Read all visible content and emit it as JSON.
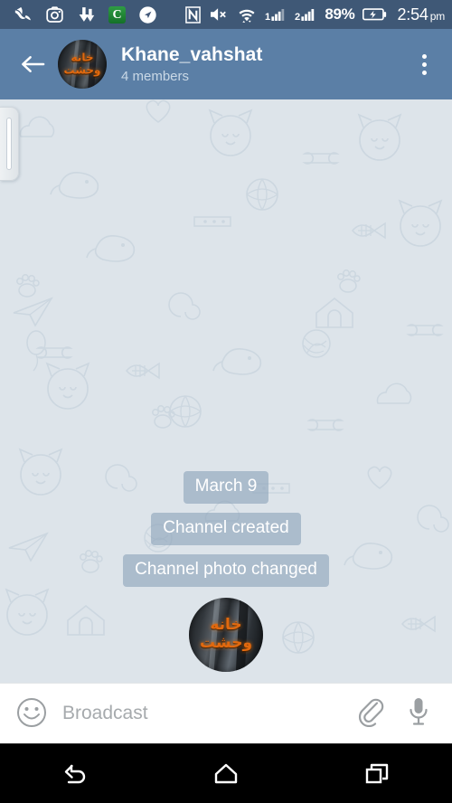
{
  "statusbar": {
    "left_icons": [
      {
        "name": "swallow-bird-icon",
        "label": "bird"
      },
      {
        "name": "instagram-camera-icon",
        "label": "camera"
      },
      {
        "name": "download-arrow-icon",
        "label": "download"
      },
      {
        "name": "c-app-icon",
        "label": "C"
      },
      {
        "name": "navigation-arrow-icon",
        "label": "navigation"
      }
    ],
    "right_icons": [
      {
        "name": "nfc-icon",
        "label": "N"
      },
      {
        "name": "speaker-mute-icon",
        "label": "muted"
      },
      {
        "name": "wifi-data-icon",
        "label": "wifi"
      },
      {
        "name": "sim1-signal-icon",
        "label": "1"
      },
      {
        "name": "sim2-signal-icon",
        "label": "2"
      }
    ],
    "battery_percent": "89%",
    "battery_state": "charging",
    "time": "2:54",
    "meridiem": "pm"
  },
  "header": {
    "back_icon": "back-arrow-icon",
    "avatar_text": "خانه وحشت",
    "title": "Khane_vahshat",
    "subtitle": "4 members",
    "menu_icon": "overflow-menu-icon",
    "bg_color": "#5b7fa6"
  },
  "chat": {
    "bg_color": "#dde4ea",
    "drawer_handle": "side-drawer-handle",
    "messages": [
      {
        "type": "date",
        "text": "March 9"
      },
      {
        "type": "service",
        "text": "Channel created"
      },
      {
        "type": "service",
        "text": "Channel photo changed"
      },
      {
        "type": "photo",
        "text": "خانه وحشت"
      }
    ]
  },
  "input": {
    "emoji_icon": "emoji-smiley-icon",
    "placeholder": "Broadcast",
    "value": "",
    "attach_icon": "paperclip-icon",
    "mic_icon": "microphone-icon"
  },
  "navbar": {
    "back_icon": "nav-back-icon",
    "home_icon": "nav-home-icon",
    "recents_icon": "nav-recents-icon"
  }
}
